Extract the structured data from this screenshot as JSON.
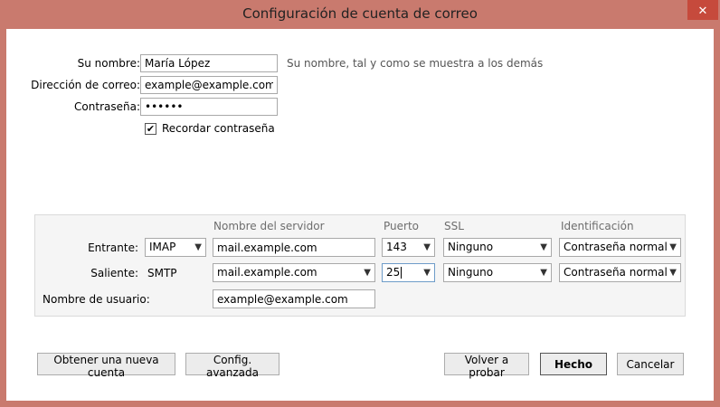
{
  "window": {
    "title": "Configuración de cuenta de correo",
    "close_glyph": "✕"
  },
  "account": {
    "name_label": "Su nombre:",
    "name_value": "María López",
    "name_hint": "Su nombre, tal y como se muestra a los demás",
    "email_label": "Dirección de correo:",
    "email_value": "example@example.com",
    "password_label": "Contraseña:",
    "password_value": "secret",
    "remember_label": "Recordar contraseña",
    "remember_checked": true
  },
  "server": {
    "headers": {
      "server_name": "Nombre del servidor",
      "port": "Puerto",
      "ssl": "SSL",
      "auth": "Identificación"
    },
    "incoming": {
      "label": "Entrante:",
      "protocol": "IMAP",
      "hostname": "mail.example.com",
      "port": "143",
      "ssl": "Ninguno",
      "auth": "Contraseña normal"
    },
    "outgoing": {
      "label": "Saliente:",
      "protocol": "SMTP",
      "hostname": "mail.example.com",
      "port": "25",
      "ssl": "Ninguno",
      "auth": "Contraseña normal"
    },
    "username_label": "Nombre de usuario:",
    "username_value": "example@example.com"
  },
  "buttons": {
    "new_account": "Obtener una nueva cuenta",
    "advanced": "Config. avanzada",
    "retest": "Volver a probar",
    "done": "Hecho",
    "cancel": "Cancelar"
  },
  "colors": {
    "titlebar": "#c97a6e",
    "close_button": "#c64a3c",
    "focus_border": "#6e9cc9"
  }
}
